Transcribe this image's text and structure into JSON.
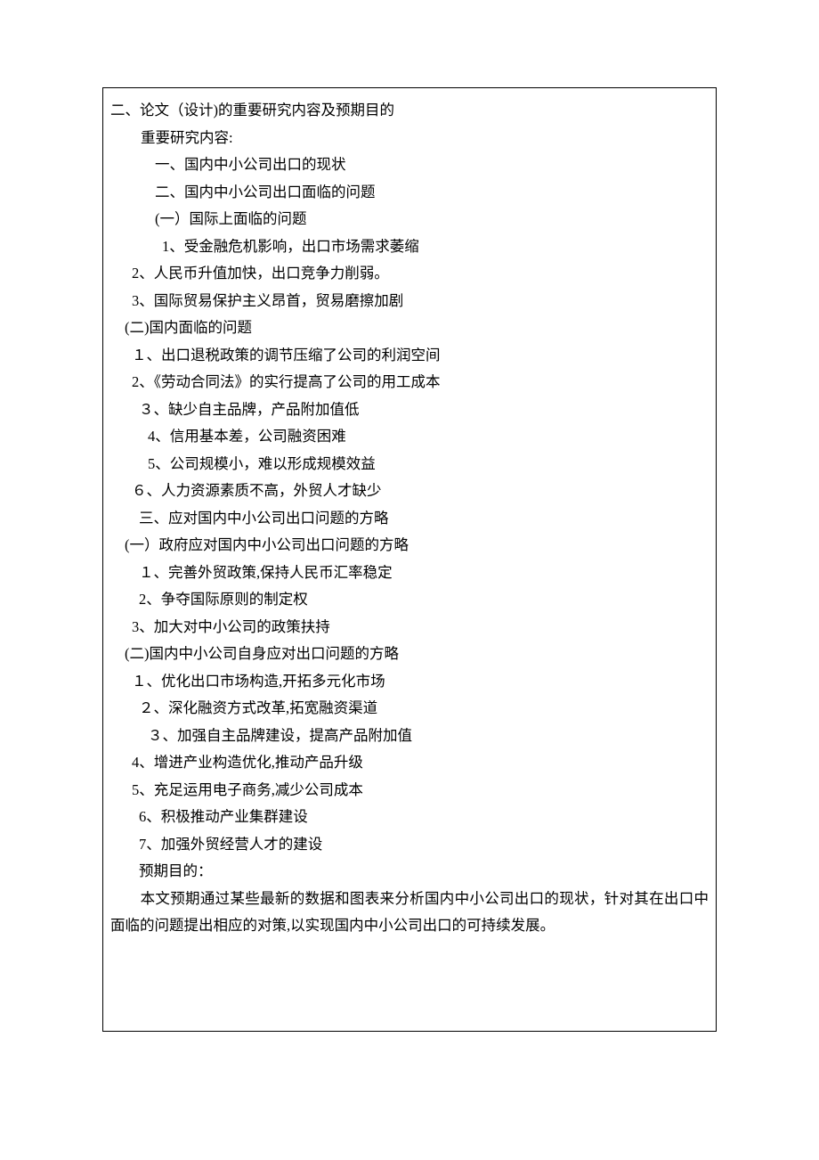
{
  "section_title": "二、论文（设计)的重要研究内容及预期目的",
  "subtitle1": "重要研究内容:",
  "h1": "一、国内中小公司出口的现状",
  "h2": "二、国内中小公司出口面临的问题",
  "s1": "(一）国际上面临的问题",
  "s1_1": "1、受金融危机影响，出口市场需求萎缩",
  "s1_2": "2、人民币升值加快，出口竞争力削弱。",
  "s1_3": "3、国际贸易保护主义昂首，贸易磨擦加剧",
  "s2": "(二)国内面临的问题",
  "s2_1": "１、出口退税政策的调节压缩了公司的利润空间",
  "s2_2": "2、《劳动合同法》的实行提高了公司的用工成本",
  "s2_3": "３、缺少自主品牌，产品附加值低",
  "s2_4": "4、信用基本差，公司融资困难",
  "s2_5": "5、公司规模小，难以形成规模效益",
  "s2_6": "６、人力资源素质不高，外贸人才缺少",
  "h3": "三、应对国内中小公司出口问题的方略",
  "s3": "(一）政府应对国内中小公司出口问题的方略",
  "s3_1": "１、完善外贸政策,保持人民币汇率稳定",
  "s3_2": "2、争夺国际原则的制定权",
  "s3_3": "3、加大对中小公司的政策扶持",
  "s4": "(二)国内中小公司自身应对出口问题的方略",
  "s4_1": "１、优化出口市场构造,开拓多元化市场",
  "s4_2": "２、深化融资方式改革,拓宽融资渠道",
  "s4_3": "３、加强自主品牌建设，提高产品附加值",
  "s4_4": "4、增进产业构造优化,推动产品升级",
  "s4_5": "5、充足运用电子商务,减少公司成本",
  "s4_6": "6、积极推动产业集群建设",
  "s4_7": "7、加强外贸经营人才的建设",
  "subtitle2": "预期目的：",
  "para1": "　　本文预期通过某些最新的数据和图表来分析国内中小公司出口的现状，针对其在出口中面临的问题提出相应的对策,以实现国内中小公司出口的可持续发展。"
}
